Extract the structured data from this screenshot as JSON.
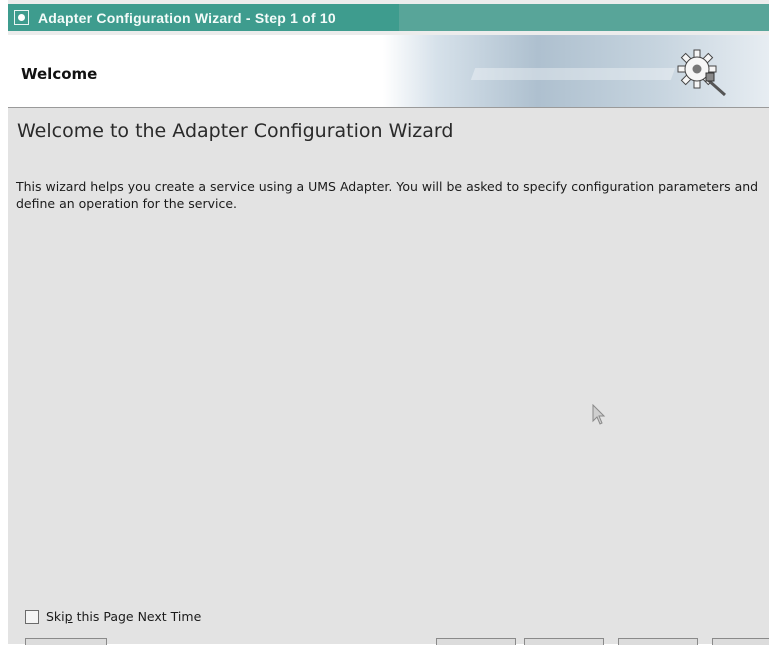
{
  "window": {
    "title": "Adapter Configuration Wizard - Step 1 of 10"
  },
  "banner": {
    "heading": "Welcome",
    "icon": "gear-plug-icon"
  },
  "content": {
    "title": "Welcome to the Adapter Configuration Wizard",
    "description": "This wizard helps you create a service using a UMS Adapter. You will be asked to specify configuration parameters and define an operation for the service."
  },
  "skip_checkbox": {
    "label_before": "Ski",
    "label_mnemonic": "p",
    "label_after": " this Page Next Time",
    "checked": false
  },
  "colors": {
    "titlebar": "#3e9c8e",
    "content_bg": "#e3e3e3"
  }
}
